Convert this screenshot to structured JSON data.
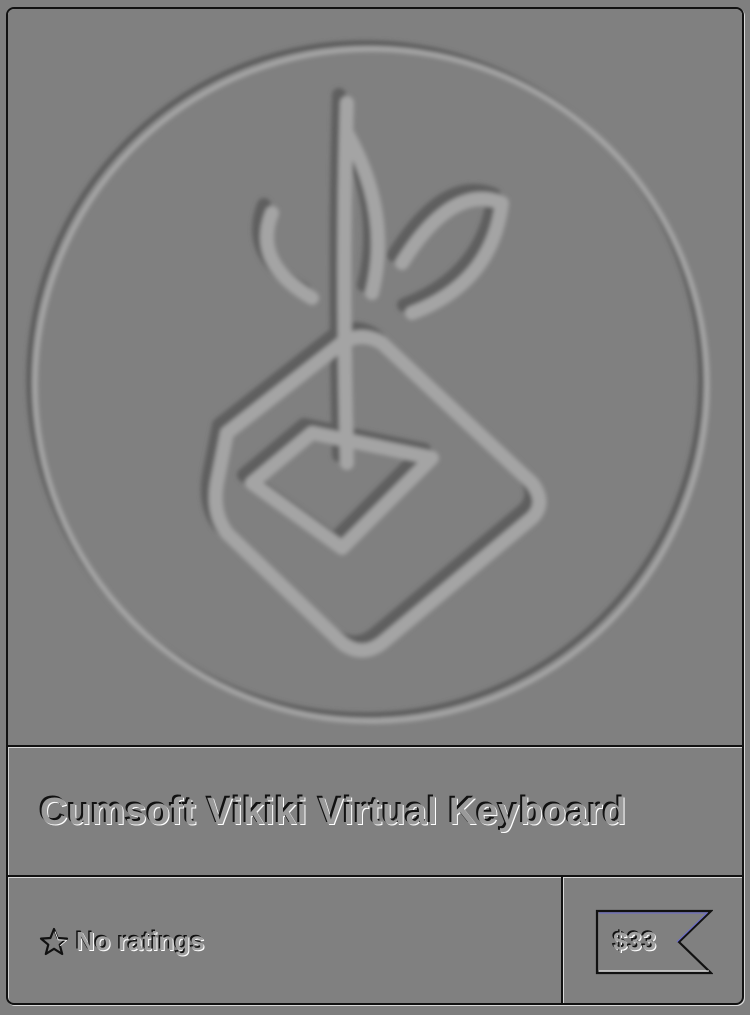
{
  "product": {
    "title": "Cumsoft Vikiki Virtual Keyboard",
    "rating_text": "No ratings",
    "price": "$33",
    "thumbnail_icon": "leaf-pot-logo-icon"
  },
  "icons": {
    "rating": "star-outline-icon",
    "price": "price-tag-icon"
  },
  "colors": {
    "background": "#808080",
    "border_dark": "#111111",
    "highlight": "#ffffff"
  }
}
